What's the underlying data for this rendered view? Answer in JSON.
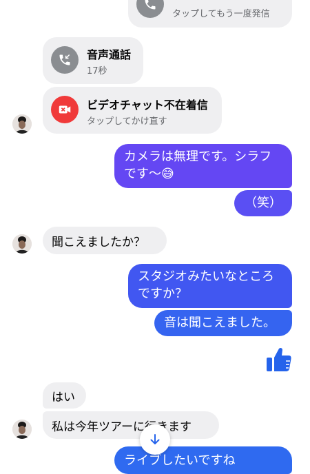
{
  "colors": {
    "incoming_bubble": "#efeff1",
    "outgoing_gradient_top": "#6b45f5",
    "outgoing_gradient_mid": "#4a5af2",
    "outgoing_bottom": "#2f6af0",
    "missed_call_red": "#f03a3a",
    "call_gray": "#8a8d91",
    "thumb_blue": "#2563eb"
  },
  "calls": [
    {
      "icon": "phone-outgoing-icon",
      "title": "",
      "subtitle": "タップしてもう一度発信"
    },
    {
      "icon": "phone-incoming-icon",
      "title": "音声通話",
      "subtitle": "17秒"
    },
    {
      "icon": "missed-video-icon",
      "title": "ビデオチャット不在着信",
      "subtitle": "タップしてかけ直す"
    }
  ],
  "messages": {
    "out1_line1": "カメラは無理です。シラフ",
    "out1_line2": "です～",
    "out1_emoji": "😅",
    "out2": "（笑）",
    "in1": "聞こえましたか？",
    "out3_line1": "スタジオみたいなところ",
    "out3_line2": "ですか？",
    "out4": "音は聞こえました。",
    "in2": "はい",
    "in3": "私は今年ツアーに行きます",
    "out5": "ライブしたいですね"
  },
  "icons": {
    "like": "thumbs-up-icon",
    "scroll_down": "arrow-down-icon"
  }
}
